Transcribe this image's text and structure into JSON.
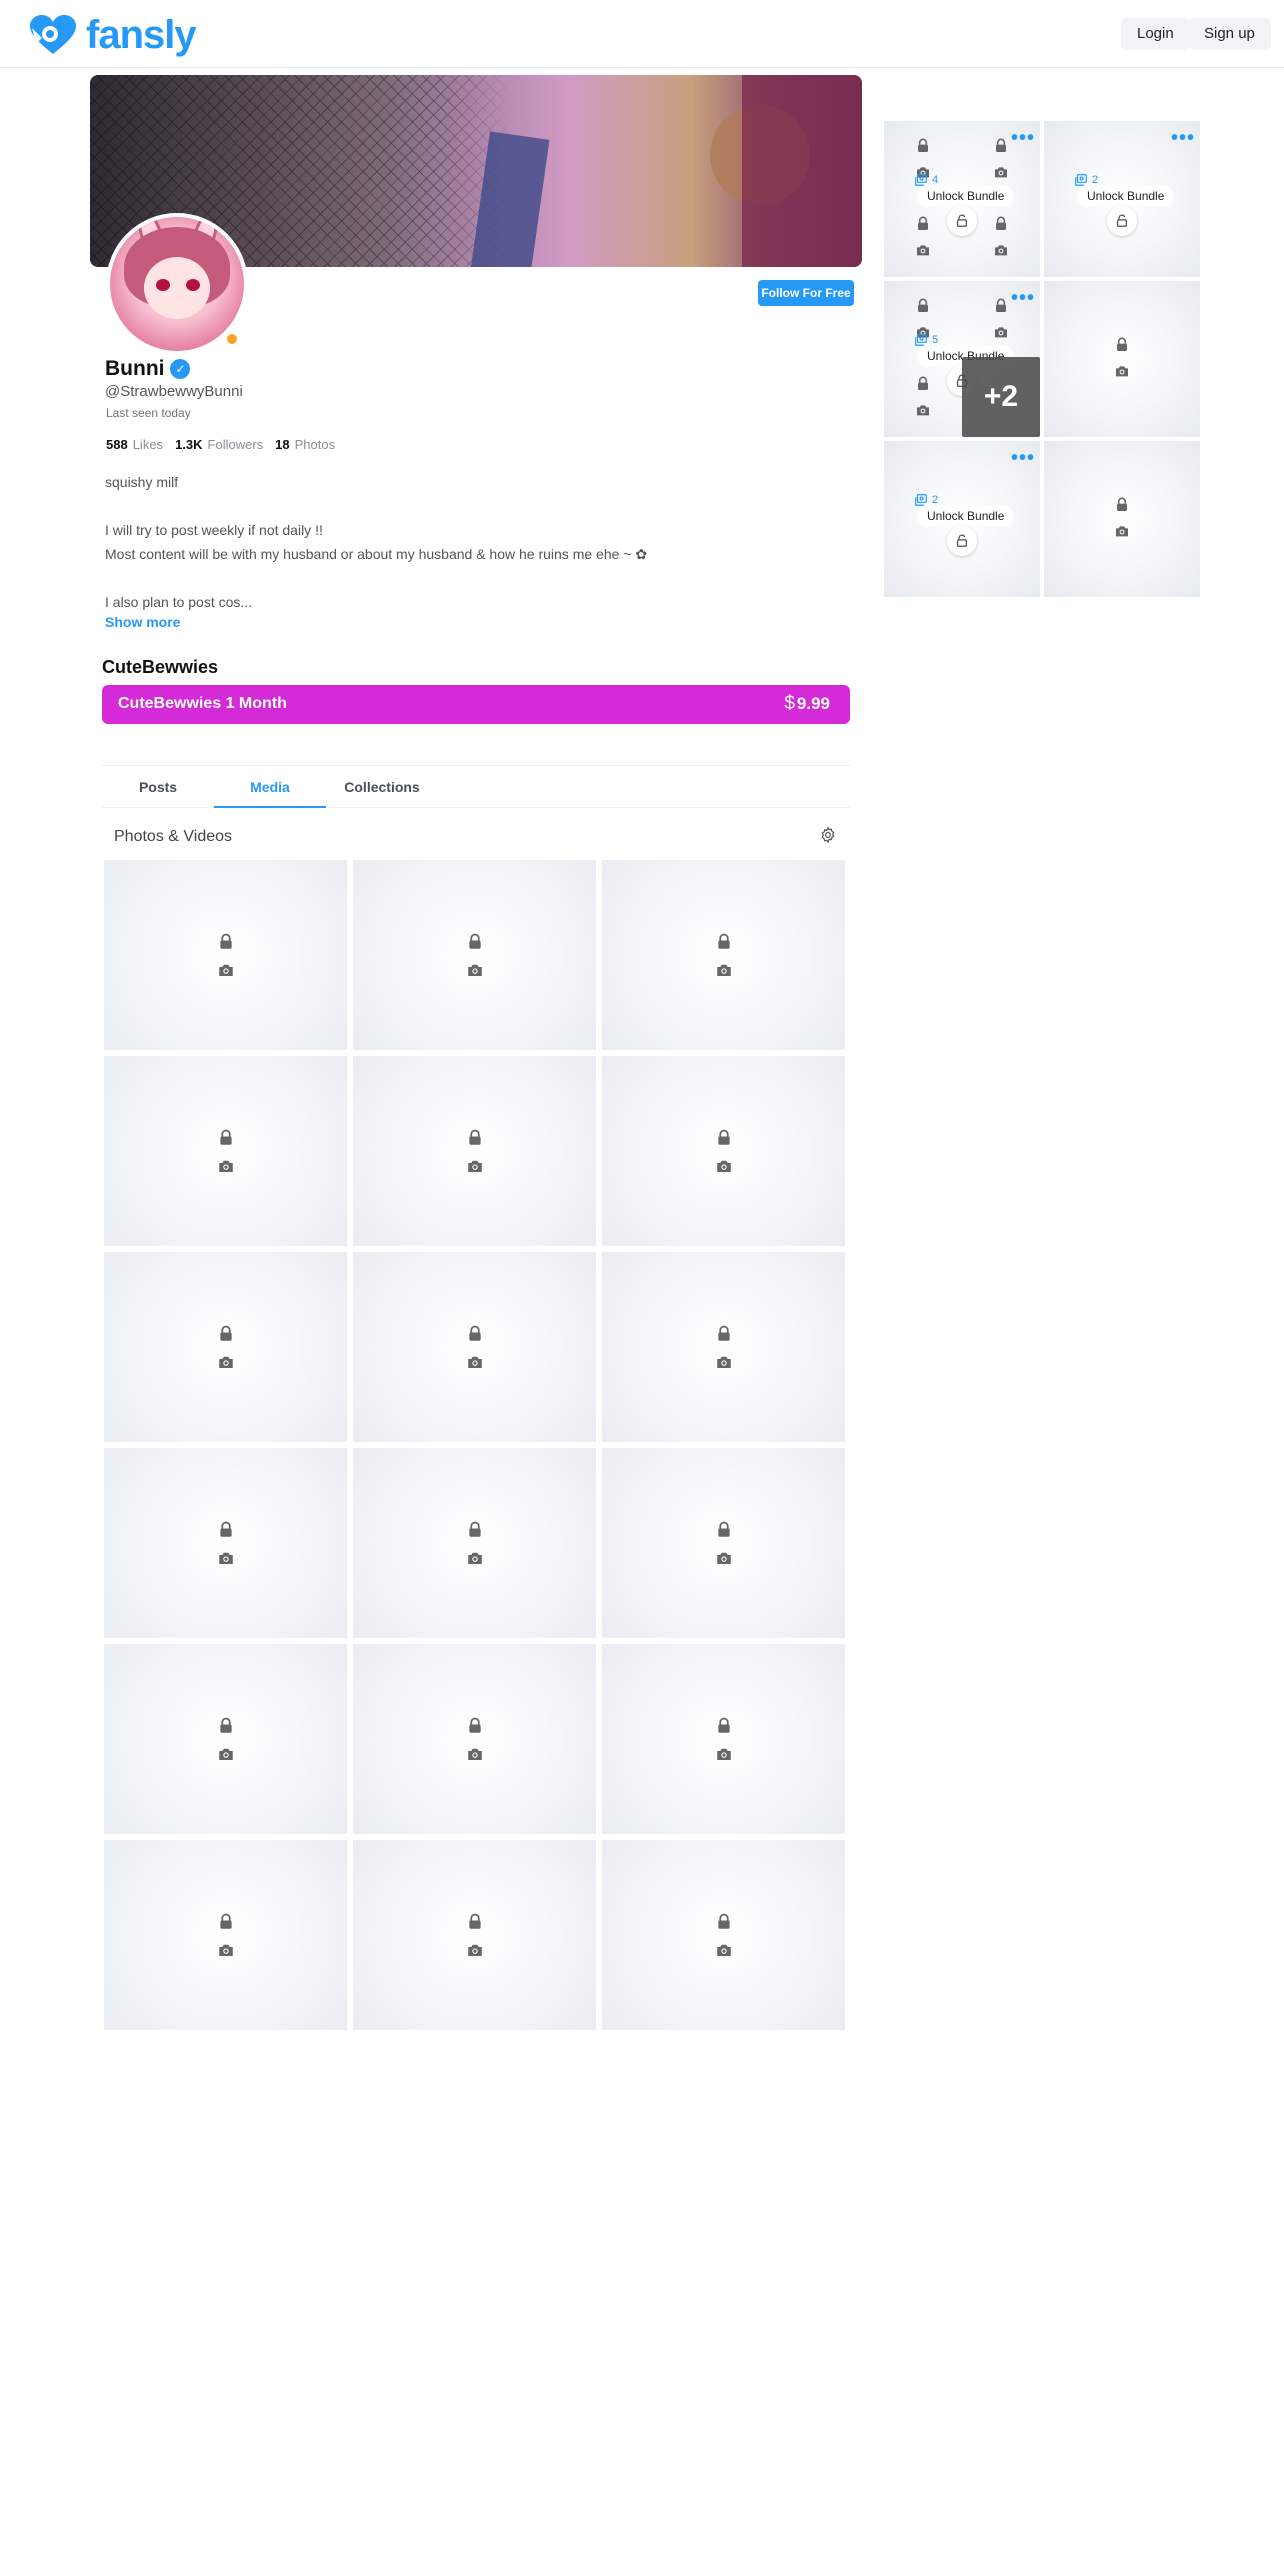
{
  "header": {
    "logo_text": "fansly",
    "login_label": "Login",
    "signup_label": "Sign up"
  },
  "profile": {
    "display_name": "Bunni",
    "username": "@StrawbewwyBunni",
    "last_seen": "Last seen today",
    "follow_label": "Follow For Free",
    "stats": [
      {
        "value": "588",
        "label": "Likes"
      },
      {
        "value": "1.3K",
        "label": "Followers"
      },
      {
        "value": "18",
        "label": "Photos"
      }
    ],
    "bio_lines": [
      "squishy milf",
      "",
      "I will try to post weekly if not daily !!",
      "Most content will be with my husband or about my husband & how he ruins me ehe ~ ✿",
      "",
      "I also plan to post cos..."
    ],
    "show_more_label": "Show more"
  },
  "subscription": {
    "title": "CuteBewwies",
    "tier_label": "CuteBewwies 1 Month",
    "currency": "$",
    "price": "9.99"
  },
  "tabs": [
    "Posts",
    "Media",
    "Collections"
  ],
  "active_tab": "Media",
  "media": {
    "section_title": "Photos & Videos",
    "tile_count": 18
  },
  "sidebar": {
    "unlock_label": "Unlock Bundle",
    "more_label": "•••",
    "bundles": [
      {
        "count": "4"
      },
      {
        "count": "2"
      },
      {
        "count": "5",
        "extra": "+2"
      },
      {
        "count": "2"
      }
    ]
  },
  "colors": {
    "brand": "#2699f7",
    "subscribe_bar": "#d42ad8",
    "online": "#f5a623"
  }
}
